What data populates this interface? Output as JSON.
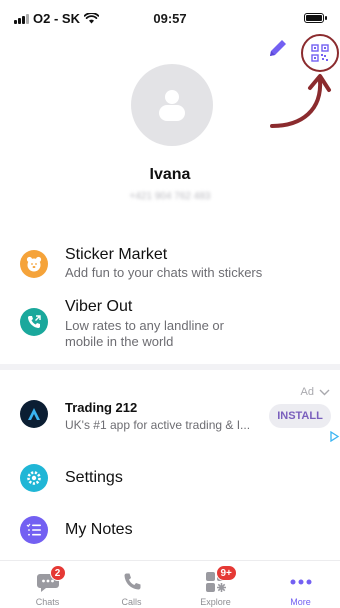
{
  "status_bar": {
    "carrier": "O2 - SK",
    "time": "09:57"
  },
  "header": {
    "edit_icon": "pencil-icon",
    "qr_icon": "qr-code-icon"
  },
  "profile": {
    "name": "Ivana",
    "phone": "+421 904 762 483",
    "avatar_icon": "person-placeholder-icon"
  },
  "menu": {
    "sticker_market": {
      "title": "Sticker Market",
      "subtitle": "Add fun to your chats with stickers",
      "icon": "sticker-bear-icon",
      "icon_color": "#f5a33a"
    },
    "viber_out": {
      "title": "Viber Out",
      "subtitle_line1": "Low rates to any landline or",
      "subtitle_line2": "mobile in the world",
      "icon": "phone-out-icon",
      "icon_color": "#1aa89c"
    },
    "settings": {
      "title": "Settings",
      "icon": "gear-icon",
      "icon_color": "#20b6d6"
    },
    "my_notes": {
      "title": "My Notes",
      "icon": "notes-checklist-icon",
      "icon_color": "#7360f2"
    }
  },
  "ad": {
    "label": "Ad",
    "title": "Trading 212",
    "description": "UK's #1 app for active trading & I...",
    "install_label": "INSTALL"
  },
  "tabs": [
    {
      "label": "Chats",
      "icon": "chat-bubble-icon",
      "badge": "2"
    },
    {
      "label": "Calls",
      "icon": "phone-icon"
    },
    {
      "label": "Explore",
      "icon": "explore-grid-icon",
      "badge": "9+"
    },
    {
      "label": "More",
      "icon": "more-dots-icon",
      "active": true
    }
  ],
  "colors": {
    "accent": "#7360f2",
    "annotation": "#8b2b2e",
    "badge": "#e53935"
  }
}
